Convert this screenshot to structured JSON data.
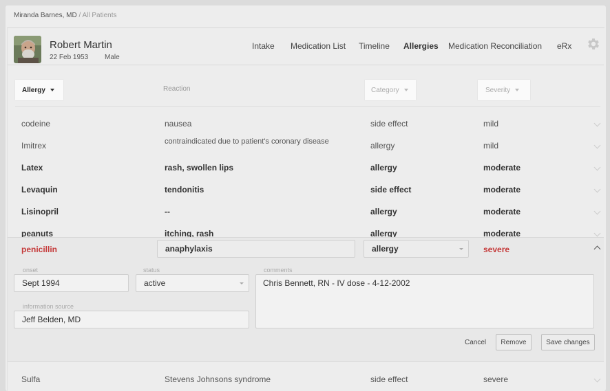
{
  "breadcrumb": {
    "user": "Miranda Barnes, MD",
    "separator": "/",
    "section": "All Patients"
  },
  "patient": {
    "name": "Robert Martin",
    "dob": "22 Feb 1953",
    "sex": "Male"
  },
  "nav": {
    "intake": "Intake",
    "medication_list": "Medication List",
    "timeline": "Timeline",
    "allergies": "Allergies",
    "medication_reconciliation": "Medication Reconciliation",
    "erx": "eRx",
    "active_tab": "Allergies"
  },
  "table_header": {
    "allergy": "Allergy",
    "reaction": "Reaction",
    "category": "Category",
    "severity": "Severity"
  },
  "rows": [
    {
      "allergy": "codeine",
      "reaction": "nausea",
      "category": "side effect",
      "severity": "mild"
    },
    {
      "allergy": "Imitrex",
      "reaction": "contraindicated due to patient's coronary disease",
      "category": "allergy",
      "severity": "mild"
    },
    {
      "allergy": "Latex",
      "reaction": "rash, swollen lips",
      "category": "allergy",
      "severity": "moderate"
    },
    {
      "allergy": "Levaquin",
      "reaction": "tendonitis",
      "category": "side effect",
      "severity": "moderate"
    },
    {
      "allergy": "Lisinopril",
      "reaction": "--",
      "category": "allergy",
      "severity": "moderate"
    },
    {
      "allergy": "peanuts",
      "reaction": "itching, rash",
      "category": "allergy",
      "severity": "moderate"
    }
  ],
  "expanded": {
    "allergy": "penicillin",
    "reaction": "anaphylaxis",
    "category": "allergy",
    "severity": "severe",
    "onset_label": "onset",
    "onset": "Sept 1994",
    "status_label": "status",
    "status": "active",
    "comments_label": "comments",
    "comments": "Chris Bennett, RN - IV dose - 4-12-2002",
    "source_label": "information source",
    "source": "Jeff Belden, MD",
    "cancel": "Cancel",
    "remove": "Remove",
    "save": "Save changes"
  },
  "last_row": {
    "allergy": "Sulfa",
    "reaction": "Stevens Johnsons syndrome",
    "category": "side effect",
    "severity": "severe"
  },
  "colors": {
    "severe_red": "#c53a3a",
    "background": "#ededed",
    "header_cell": "#fafafa"
  }
}
